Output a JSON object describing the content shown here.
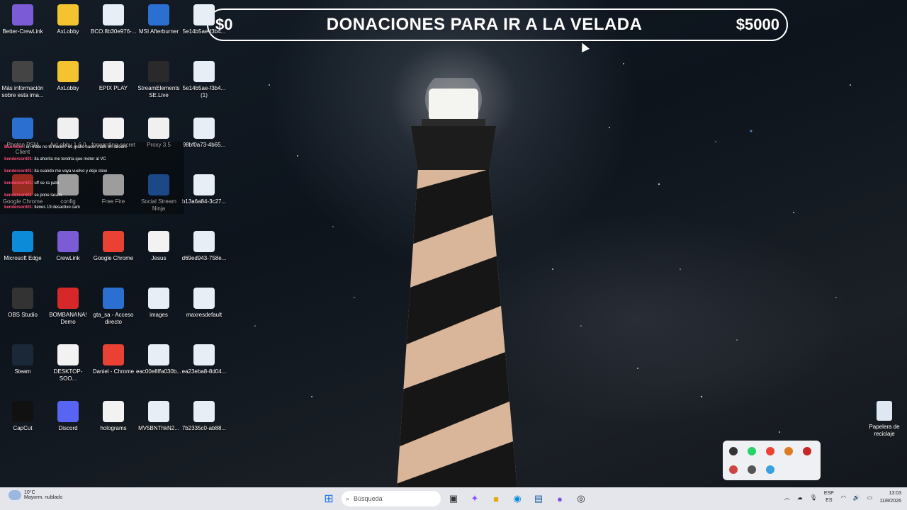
{
  "desktop_icons": [
    {
      "label": "Better-CrewLink",
      "icon": "crewlink-icon"
    },
    {
      "label": "AxLobby",
      "icon": "folder-icon"
    },
    {
      "label": "BCO.8b30e976-...",
      "icon": "image-file-icon"
    },
    {
      "label": "MSI Afterburner",
      "icon": "app-icon"
    },
    {
      "label": "5e14b5ae-f3b4...",
      "icon": "image-file-icon"
    },
    {
      "label": "Más información sobre esta ima...",
      "icon": "info-icon"
    },
    {
      "label": "AxLobby",
      "icon": "folder-icon"
    },
    {
      "label": "EPIX PLAY",
      "icon": "file-icon"
    },
    {
      "label": "StreamElements SE.Live",
      "icon": "streamelements-icon"
    },
    {
      "label": "5e14b5ae-f3b4... (1)",
      "icon": "image-file-icon"
    },
    {
      "label": "Photon PSM Client",
      "icon": "app-icon"
    },
    {
      "label": "AxLobby 1.6.0",
      "icon": "java-icon"
    },
    {
      "label": "forwarding-secret",
      "icon": "file-icon"
    },
    {
      "label": "Proxy 3.5",
      "icon": "java-icon"
    },
    {
      "label": "98bf0a73-4b65...",
      "icon": "image-file-icon"
    },
    {
      "label": "Google Chrome",
      "icon": "chrome-icon"
    },
    {
      "label": "config",
      "icon": "file-icon"
    },
    {
      "label": "Free Fire",
      "icon": "file-icon"
    },
    {
      "label": "Social Stream Ninja",
      "icon": "app-icon"
    },
    {
      "label": "b13a6a84-3c27...",
      "icon": "image-file-icon"
    },
    {
      "label": "Microsoft Edge",
      "icon": "edge-icon"
    },
    {
      "label": "CrewLink",
      "icon": "crewlink-icon"
    },
    {
      "label": "Google Chrome",
      "icon": "chrome-icon"
    },
    {
      "label": "Jesus",
      "icon": "chrome-file-icon"
    },
    {
      "label": "d69ed943-758e...",
      "icon": "image-file-icon"
    },
    {
      "label": "OBS Studio",
      "icon": "obs-icon"
    },
    {
      "label": "BOMBANANA! Demo",
      "icon": "game-icon"
    },
    {
      "label": "gta_sa - Acceso directo",
      "icon": "app-icon"
    },
    {
      "label": "images",
      "icon": "image-file-icon"
    },
    {
      "label": "maxresdefault",
      "icon": "image-file-icon"
    },
    {
      "label": "Steam",
      "icon": "steam-icon"
    },
    {
      "label": "DESKTOP-SOO...",
      "icon": "file-icon"
    },
    {
      "label": "Daniel - Chrome",
      "icon": "chrome-icon"
    },
    {
      "label": "eac00e8ffa030b...",
      "icon": "image-file-icon"
    },
    {
      "label": "ea23eba8-8d04...",
      "icon": "image-file-icon"
    },
    {
      "label": "CapCut",
      "icon": "capcut-icon"
    },
    {
      "label": "Discord",
      "icon": "discord-icon"
    },
    {
      "label": "holograms",
      "icon": "file-icon"
    },
    {
      "label": "MV5BNThkN2...",
      "icon": "image-file-icon"
    },
    {
      "label": "7b2335c0-ab88...",
      "icon": "image-file-icon"
    }
  ],
  "banner": {
    "left": "$0",
    "title": "DONACIONES PARA IR A LA VELADA",
    "right": "$5000"
  },
  "chat": [
    {
      "user": "Banmuko",
      "msg": "un mate no te haces? es gratis hacer mate en stream"
    },
    {
      "user": "kendersont01",
      "msg": "ita ahorita me tendria que meter al VC"
    },
    {
      "user": "kendersont01",
      "msg": "ita cuando me vaya vuelvo y dejo stew"
    },
    {
      "user": "kendersont01",
      "msg": "uff se ra pato"
    },
    {
      "user": "kendersont01",
      "msg": "se pone lacam"
    },
    {
      "user": "kendersont01",
      "msg": "tienes 19 desactivo cam"
    }
  ],
  "taskbar": {
    "weather_temp": "10°C",
    "weather_desc": "Mayorm. nublado",
    "search_placeholder": "Búsqueda",
    "lang_top": "ESP",
    "lang_bottom": "ES",
    "time": "13:03",
    "date": "11/8/2026"
  },
  "recycle_bin": {
    "label": "Papelera de reciclaje"
  }
}
